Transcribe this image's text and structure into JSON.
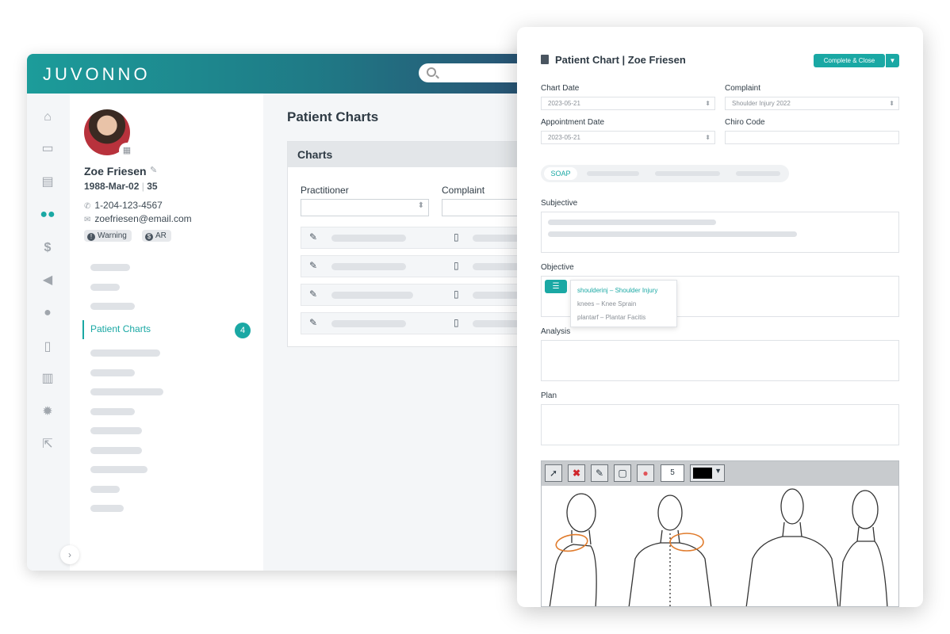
{
  "app": {
    "logo": "JUVONNO"
  },
  "patient": {
    "name": "Zoe Friesen",
    "dob": "1988-Mar-02",
    "age": "35",
    "phone": "1-204-123-4567",
    "email": "zoefriesen@email.com",
    "badges": [
      "Warning",
      "AR"
    ]
  },
  "sidebar": {
    "active_label": "Patient Charts",
    "active_count": "4"
  },
  "main": {
    "title": "Patient Charts",
    "section": "Charts",
    "columns": [
      "Practitioner",
      "Complaint"
    ]
  },
  "modal": {
    "title": "Patient Chart",
    "title_sep": "|",
    "title_patient": "Zoe Friesen",
    "complete_button": "Complete & Close",
    "fields": {
      "chart_date_label": "Chart Date",
      "chart_date": "2023-05-21",
      "complaint_label": "Complaint",
      "complaint": "Shoulder Injury 2022",
      "appointment_date_label": "Appointment Date",
      "appointment_date": "2023-05-21",
      "chiro_code_label": "Chiro Code",
      "chiro_code": ""
    },
    "tabs": {
      "active": "SOAP"
    },
    "sections": {
      "subjective": "Subjective",
      "objective": "Objective",
      "analysis": "Analysis",
      "plan": "Plan"
    },
    "templates": [
      "shoulderinj – Shoulder Injury",
      "knees – Knee Sprain",
      "plantarf – Plantar Facitis"
    ],
    "drawing": {
      "brush_size": "5",
      "color": "#000000"
    }
  }
}
